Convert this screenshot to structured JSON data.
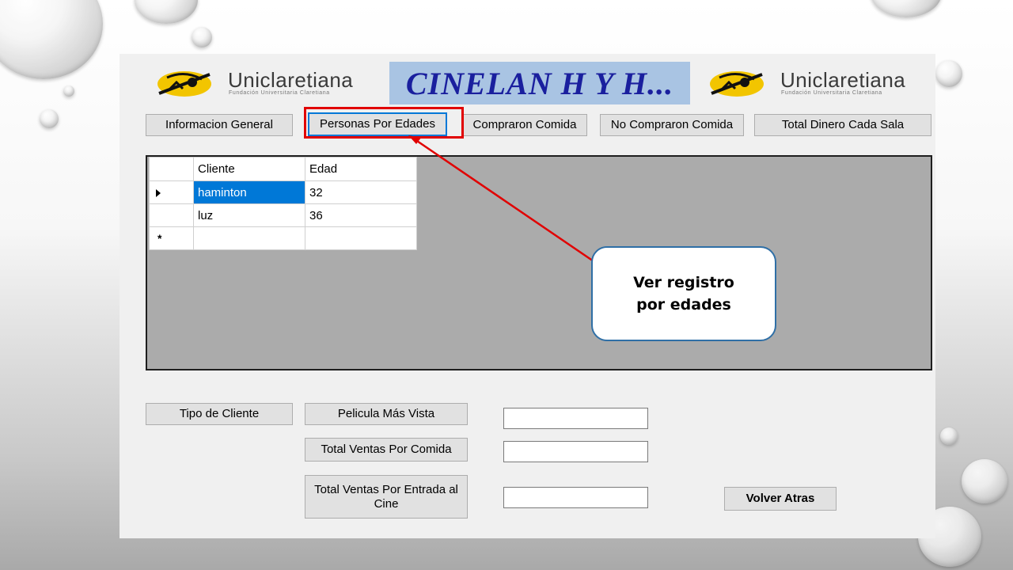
{
  "header": {
    "logo_left": {
      "name": "Uniclaretiana",
      "subtitle": "Fundación Universitaria Claretiana"
    },
    "logo_right": {
      "name": "Uniclaretiana",
      "subtitle": "Fundación Universitaria Claretiana"
    },
    "title": "CINELAN H Y H..."
  },
  "top_buttons": [
    "Informacion General",
    "Personas Por Edades",
    "Compraron Comida",
    "No Compraron Comida",
    "Total Dinero Cada Sala"
  ],
  "grid": {
    "columns": [
      "Cliente",
      "Edad"
    ],
    "rows": [
      {
        "cliente": "haminton",
        "edad": "32",
        "selected": true
      },
      {
        "cliente": "luz",
        "edad": "36",
        "selected": false
      }
    ]
  },
  "bottom_buttons": {
    "tipo_cliente": "Tipo de Cliente",
    "pelicula_mas_vista": "Pelicula Más Vista",
    "total_ventas_comida": "Total Ventas Por Comida",
    "total_ventas_entrada": "Total Ventas Por Entrada al Cine",
    "volver": "Volver Atras"
  },
  "fields": {
    "pelicula_mas_vista_value": "",
    "total_ventas_comida_value": "",
    "total_ventas_entrada_value": ""
  },
  "annotation": {
    "callout_text": "Ver registro por edades",
    "colors": {
      "highlight": "#e10000",
      "callout_border": "#2f6fa6"
    }
  },
  "colors": {
    "selection": "#0078d7",
    "title_bg": "#a9c4e3",
    "title_text": "#1a1f9e",
    "logo_yellow": "#f2c500"
  }
}
